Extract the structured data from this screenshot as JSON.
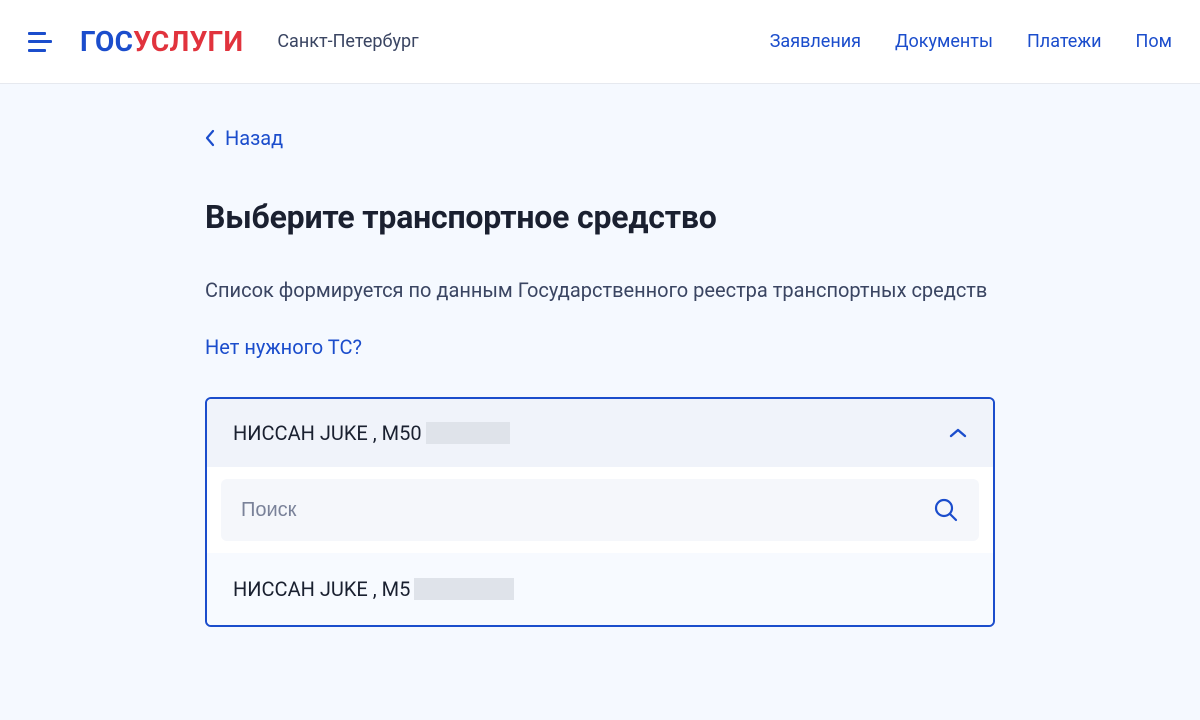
{
  "header": {
    "logo_part1": "ГОС",
    "logo_part2": "УСЛУГИ",
    "city": "Санкт-Петербург",
    "nav": {
      "applications": "Заявления",
      "documents": "Документы",
      "payments": "Платежи",
      "help": "Пом"
    }
  },
  "back": "Назад",
  "title": "Выберите транспортное средство",
  "description": "Список формируется по данным Государственного реестра транспортных средств",
  "help_link": "Нет нужного ТС?",
  "dropdown": {
    "selected_prefix": "НИССАН JUKE , М50",
    "search_placeholder": "Поиск",
    "option_prefix": "НИССАН JUKE , М5"
  }
}
